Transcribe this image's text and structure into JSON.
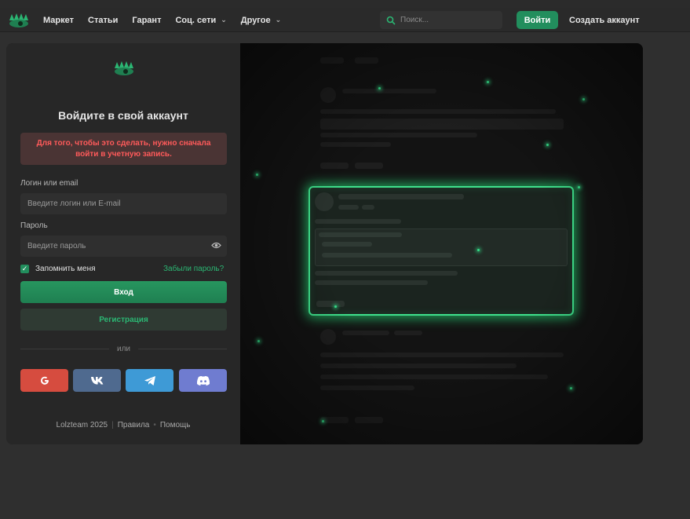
{
  "navbar": {
    "items": [
      {
        "label": "Маркет",
        "has_dropdown": false
      },
      {
        "label": "Статьи",
        "has_dropdown": false
      },
      {
        "label": "Гарант",
        "has_dropdown": false
      },
      {
        "label": "Соц. сети",
        "has_dropdown": true
      },
      {
        "label": "Другое",
        "has_dropdown": true
      }
    ],
    "search_placeholder": "Поиск...",
    "login_label": "Войти",
    "create_account_label": "Создать аккаунт"
  },
  "login": {
    "title": "Войдите в свой аккаунт",
    "alert": "Для того, чтобы это сделать, нужно сначала войти в учетную запись.",
    "login_label": "Логин или email",
    "login_placeholder": "Введите логин или E-mail",
    "password_label": "Пароль",
    "password_placeholder": "Введите пароль",
    "remember_label": "Запомнить меня",
    "remember_checked": true,
    "forgot_label": "Забыли пароль?",
    "enter_label": "Вход",
    "register_label": "Регистрация",
    "or_label": "или",
    "social": [
      {
        "name": "google-icon",
        "color": "#d64c3f"
      },
      {
        "name": "vk-icon",
        "color": "#4f6a8f"
      },
      {
        "name": "telegram-icon",
        "color": "#3e9ad6"
      },
      {
        "name": "discord-icon",
        "color": "#6f7cd0"
      }
    ]
  },
  "footer": {
    "copyright": "Lolzteam 2025",
    "rules": "Правила",
    "help": "Помощь"
  },
  "colors": {
    "accent": "#228e5d",
    "accent_text": "#2bb673",
    "error_text": "#ff5a5a",
    "background": "#2f2f2f"
  }
}
